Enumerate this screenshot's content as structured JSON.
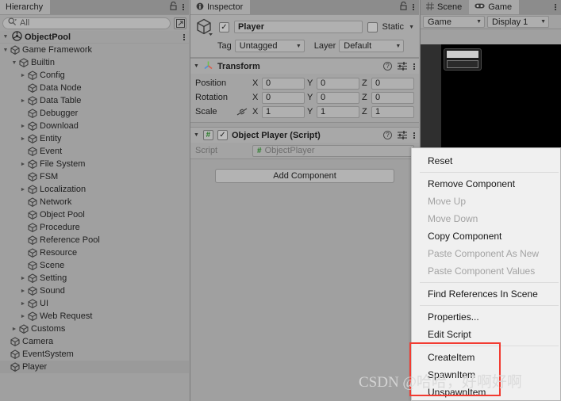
{
  "hierarchy": {
    "tab_label": "Hierarchy",
    "lock_icon": "lock-icon",
    "menu_icon": "kebab-icon",
    "search": {
      "placeholder": "All",
      "icon": "search-icon",
      "expand_icon": "expand-icon"
    },
    "scene_name": "ObjectPool",
    "nodes": [
      {
        "label": "Game Framework",
        "depth": 1,
        "arrow": "down",
        "icon": "gameobject-icon"
      },
      {
        "label": "Builtin",
        "depth": 2,
        "arrow": "down",
        "icon": "gameobject-icon"
      },
      {
        "label": "Config",
        "depth": 3,
        "arrow": "right",
        "icon": "gameobject-icon"
      },
      {
        "label": "Data Node",
        "depth": 3,
        "arrow": "none",
        "icon": "gameobject-icon"
      },
      {
        "label": "Data Table",
        "depth": 3,
        "arrow": "right",
        "icon": "gameobject-icon"
      },
      {
        "label": "Debugger",
        "depth": 3,
        "arrow": "none",
        "icon": "gameobject-icon"
      },
      {
        "label": "Download",
        "depth": 3,
        "arrow": "right",
        "icon": "gameobject-icon"
      },
      {
        "label": "Entity",
        "depth": 3,
        "arrow": "right",
        "icon": "gameobject-icon"
      },
      {
        "label": "Event",
        "depth": 3,
        "arrow": "none",
        "icon": "gameobject-icon"
      },
      {
        "label": "File System",
        "depth": 3,
        "arrow": "right",
        "icon": "gameobject-icon"
      },
      {
        "label": "FSM",
        "depth": 3,
        "arrow": "none",
        "icon": "gameobject-icon"
      },
      {
        "label": "Localization",
        "depth": 3,
        "arrow": "right",
        "icon": "gameobject-icon"
      },
      {
        "label": "Network",
        "depth": 3,
        "arrow": "none",
        "icon": "gameobject-icon"
      },
      {
        "label": "Object Pool",
        "depth": 3,
        "arrow": "none",
        "icon": "gameobject-icon"
      },
      {
        "label": "Procedure",
        "depth": 3,
        "arrow": "none",
        "icon": "gameobject-icon"
      },
      {
        "label": "Reference Pool",
        "depth": 3,
        "arrow": "none",
        "icon": "gameobject-icon"
      },
      {
        "label": "Resource",
        "depth": 3,
        "arrow": "none",
        "icon": "gameobject-icon"
      },
      {
        "label": "Scene",
        "depth": 3,
        "arrow": "none",
        "icon": "gameobject-icon"
      },
      {
        "label": "Setting",
        "depth": 3,
        "arrow": "right",
        "icon": "gameobject-icon"
      },
      {
        "label": "Sound",
        "depth": 3,
        "arrow": "right",
        "icon": "gameobject-icon"
      },
      {
        "label": "UI",
        "depth": 3,
        "arrow": "right",
        "icon": "gameobject-icon"
      },
      {
        "label": "Web Request",
        "depth": 3,
        "arrow": "right",
        "icon": "gameobject-icon"
      },
      {
        "label": "Customs",
        "depth": 2,
        "arrow": "right",
        "icon": "gameobject-icon"
      },
      {
        "label": "Camera",
        "depth": 1,
        "arrow": "none",
        "icon": "gameobject-icon"
      },
      {
        "label": "EventSystem",
        "depth": 1,
        "arrow": "none",
        "icon": "gameobject-icon"
      },
      {
        "label": "Player",
        "depth": 1,
        "arrow": "none",
        "icon": "gameobject-icon",
        "selected": true
      }
    ]
  },
  "inspector": {
    "tab_label": "Inspector",
    "object": {
      "name": "Player",
      "enabled": true,
      "static_label": "Static",
      "tag_label": "Tag",
      "tag_value": "Untagged",
      "layer_label": "Layer",
      "layer_value": "Default"
    },
    "transform": {
      "title": "Transform",
      "rows": [
        {
          "name": "Position",
          "x": "0",
          "y": "0",
          "z": "0"
        },
        {
          "name": "Rotation",
          "x": "0",
          "y": "0",
          "z": "0"
        },
        {
          "name": "Scale",
          "x": "1",
          "y": "1",
          "z": "1"
        }
      ],
      "axis_labels": [
        "X",
        "Y",
        "Z"
      ]
    },
    "script_component": {
      "title": "Object Player (Script)",
      "enabled": true,
      "script_label": "Script",
      "script_value": "ObjectPlayer"
    },
    "add_component_label": "Add Component"
  },
  "gameview": {
    "scene_tab": "Scene",
    "game_tab": "Game",
    "toolbar": {
      "view_value": "Game",
      "display_value": "Display 1"
    }
  },
  "context_menu": {
    "items": [
      {
        "label": "Reset",
        "disabled": false,
        "separator_after": true
      },
      {
        "label": "Remove Component",
        "disabled": false
      },
      {
        "label": "Move Up",
        "disabled": true
      },
      {
        "label": "Move Down",
        "disabled": true
      },
      {
        "label": "Copy Component",
        "disabled": false
      },
      {
        "label": "Paste Component As New",
        "disabled": true
      },
      {
        "label": "Paste Component Values",
        "disabled": true,
        "separator_after": true
      },
      {
        "label": "Find References In Scene",
        "disabled": false,
        "separator_after": true
      },
      {
        "label": "Properties...",
        "disabled": false
      },
      {
        "label": "Edit Script",
        "disabled": false,
        "separator_after": true
      },
      {
        "label": "CreateItem",
        "disabled": false
      },
      {
        "label": "SpawnItem",
        "disabled": false
      },
      {
        "label": "UnspawnItem",
        "disabled": false
      }
    ],
    "highlight_color": "#f23b31"
  },
  "watermark": {
    "text": "CSDN @哈哈，好啊好啊"
  }
}
